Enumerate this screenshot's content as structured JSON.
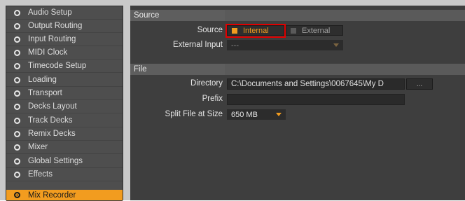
{
  "sidebar": {
    "items": [
      {
        "label": "Audio Setup"
      },
      {
        "label": "Output Routing"
      },
      {
        "label": "Input Routing"
      },
      {
        "label": "MIDI Clock"
      },
      {
        "label": "Timecode Setup"
      },
      {
        "label": "Loading"
      },
      {
        "label": "Transport"
      },
      {
        "label": "Decks Layout"
      },
      {
        "label": "Track Decks"
      },
      {
        "label": "Remix Decks"
      },
      {
        "label": "Mixer"
      },
      {
        "label": "Global Settings"
      },
      {
        "label": "Effects"
      },
      {
        "label": "Mix Recorder"
      }
    ],
    "active_index": 13
  },
  "source_section": {
    "header": "Source",
    "source_label": "Source",
    "internal_label": "Internal",
    "external_label": "External",
    "selected": "Internal",
    "external_input_label": "External Input",
    "external_input_value": "---"
  },
  "file_section": {
    "header": "File",
    "directory_label": "Directory",
    "directory_value": "C:\\Documents and Settings\\0067645\\My D",
    "browse_label": "...",
    "prefix_label": "Prefix",
    "prefix_value": "",
    "split_label": "Split File at Size",
    "split_value": "650 MB"
  },
  "colors": {
    "accent": "#f29c1f",
    "highlight_box": "#e00000"
  }
}
